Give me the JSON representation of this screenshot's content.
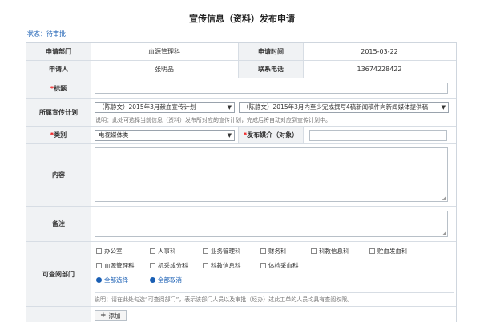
{
  "page": {
    "title": "宣传信息（资料）发布申请",
    "status": "状态：待审批"
  },
  "form": {
    "dept_label": "申请部门",
    "dept_value": "血源管理科",
    "time_label": "申请时间",
    "time_value": "2015-03-22",
    "applicant_label": "申请人",
    "applicant_value": "张明晶",
    "phone_label": "联系电话",
    "phone_value": "13674228422",
    "title_label": "标题",
    "title_value": "",
    "plan_label": "所属宣传计划",
    "plan_select_1": "（陈静文）2015年3月献血宣传计划",
    "plan_select_2": "（陈静文）2015年3月内至少完成撰写4稿新闻稿件向新闻媒体提供稿",
    "plan_hint": "说明：此处可选择当前信息（资料）发布所对应的宣传计划，完成后将自动对应到宣传计划中。",
    "category_label": "类别",
    "category_value": "电视媒体类",
    "media_label": "发布媒介（对象）",
    "media_value": "",
    "content_label": "内容",
    "remark_label": "备注",
    "viewers_label": "可查阅部门",
    "departments": [
      "办公室",
      "人事科",
      "业务管理科",
      "财务科",
      "科教信息科",
      "贮血发血科",
      "血源管理科",
      "机采成分科",
      "科教信息科",
      "体检采血科"
    ],
    "select_all": "全部选择",
    "deselect_all": "全部取消",
    "viewers_hint": "说明：请在此处勾选“可查阅部门”，表示该部门人员以及审批（经办）过此工单的人员均具有查阅权限。",
    "add_button": "添加"
  },
  "colors": {
    "accent": "#1a5fb4",
    "required": "#ee0000",
    "label_bg": "#f0f2f4"
  }
}
